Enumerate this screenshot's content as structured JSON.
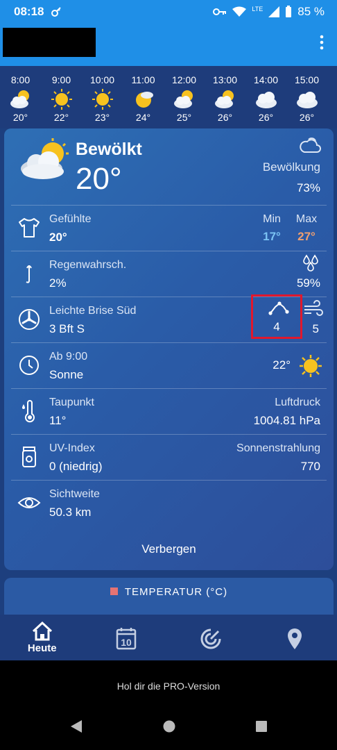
{
  "status_bar": {
    "time": "08:18",
    "battery": "85 %",
    "network": "LTE"
  },
  "hourly": [
    {
      "time": "8:00",
      "temp": "20°",
      "icon": "partly-cloudy-icon"
    },
    {
      "time": "9:00",
      "temp": "22°",
      "icon": "sun-icon"
    },
    {
      "time": "10:00",
      "temp": "23°",
      "icon": "sun-icon"
    },
    {
      "time": "11:00",
      "temp": "24°",
      "icon": "sun-cloud-icon"
    },
    {
      "time": "12:00",
      "temp": "25°",
      "icon": "partly-cloudy-icon"
    },
    {
      "time": "13:00",
      "temp": "26°",
      "icon": "partly-cloudy-icon"
    },
    {
      "time": "14:00",
      "temp": "26°",
      "icon": "cloudy-icon"
    },
    {
      "time": "15:00",
      "temp": "26°",
      "icon": "cloudy-icon"
    }
  ],
  "current": {
    "condition": "Bewölkt",
    "temp": "20°",
    "cloud_label": "Bewölkung",
    "cloud_value": "73%"
  },
  "details": {
    "feels_label": "Gefühlte",
    "feels_value": "20°",
    "min_label": "Min",
    "min_value": "17°",
    "max_label": "Max",
    "max_value": "27°",
    "rain_label": "Regenwahrsch.",
    "rain_value": "2%",
    "rain_amount": "59%",
    "wind_label": "Leichte Brise Süd",
    "wind_value": "3 Bft S",
    "gust_value": "4",
    "wind_speed_value": "5",
    "from_label": "Ab 9:00",
    "from_value": "Sonne",
    "from_temp": "22°",
    "dew_label": "Taupunkt",
    "dew_value": "11°",
    "pressure_label": "Luftdruck",
    "pressure_value": "1004.81 hPa",
    "uv_label": "UV-Index",
    "uv_value": "0 (niedrig)",
    "radiation_label": "Sonnenstrahlung",
    "radiation_value": "770",
    "visibility_label": "Sichtweite",
    "visibility_value": "50.3 km"
  },
  "hide_button": "Verbergen",
  "temp_card_legend": "TEMPERATUR (°C)",
  "nav": {
    "today": "Heute",
    "calendar_day": "10"
  },
  "ad_text": "Hol dir die PRO-Version",
  "colors": {
    "app_bar": "#1f8fe7",
    "background": "#1d3f7e",
    "min_temp": "#7cc4f4",
    "max_temp": "#f0a070",
    "highlight_box": "#e0182d"
  }
}
